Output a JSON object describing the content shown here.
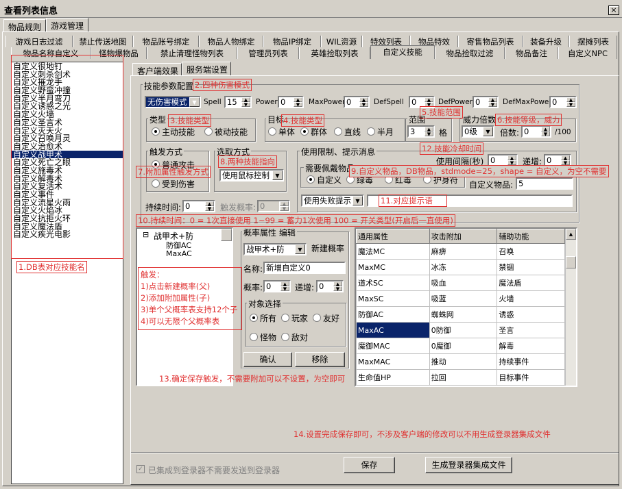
{
  "window": {
    "title": "查看列表信息",
    "close": "×"
  },
  "top_tabs": [
    "物品规则",
    "游戏管理"
  ],
  "func_tabs_row1": [
    "游戏日志过滤",
    "禁止传送地图",
    "物品账号绑定",
    "物品人物绑定",
    "物品IP绑定",
    "WIL资源",
    "特效列表",
    "物品特效",
    "寄售物品列表",
    "装备升级",
    "摆摊列表"
  ],
  "func_tabs_row2": [
    "物品名称自定义",
    "怪物爆物品",
    "禁止清理怪物列表",
    "管理员列表",
    "英雄捡取列表",
    "自定义技能",
    "物品捡取过滤",
    "物品备注",
    "自定义NPC"
  ],
  "skill_list": [
    "自定义很地钉",
    "自定义刺杀剑术",
    "自定义摧龙手",
    "自定义野蛮冲撞",
    "自定义半月弯刀",
    "自定义诱惑之光",
    "自定义火墙",
    "自定义圣言术",
    "自定义灭天火",
    "自定义召唤月灵",
    "自定义治愈术",
    "自定义战甲术",
    "自定义死亡之眼",
    "自定义施毒术",
    "自定义解毒术",
    "自定义复活术",
    "自定义事件",
    "自定义流星火雨",
    "自定义火焰冰",
    "自定义抗拒火环",
    "自定义魔法盾",
    "自定义疾光电影"
  ],
  "sub_tabs": [
    "客户端效果",
    "服务端设置"
  ],
  "params": {
    "group": "技能参数配置",
    "damage_mode": "无伤害模式",
    "spell_label": "Spell",
    "spell": "15",
    "power_label": "Power",
    "power": "0",
    "maxpower_label": "MaxPower",
    "maxpower": "0",
    "defspell_label": "DefSpell",
    "defspell": "0",
    "defpower_label": "DefPower",
    "defpower": "0",
    "defmaxpower_label": "DefMaxPower",
    "defmaxpower": "0"
  },
  "type_group": {
    "label": "类型",
    "opt1": "主动技能",
    "opt2": "被动技能"
  },
  "target_group": {
    "label": "目标",
    "opt1": "单体",
    "opt2": "群体",
    "opt3": "直线",
    "opt4": "半月"
  },
  "range_group": {
    "label": "范围",
    "value": "3",
    "unit": "格"
  },
  "power_group": {
    "label": "威力倍数",
    "level": "0级",
    "mult_label": "倍数:",
    "mult": "0",
    "suffix": "/100"
  },
  "trigger_group": {
    "label": "触发方式",
    "opt1": "普通攻击",
    "opt2": "受到伤害"
  },
  "select_group": {
    "label": "选取方式",
    "value": "使用鼠标控制"
  },
  "limit_group": {
    "label": "使用限制、提示消息",
    "interval_label": "使用间隔(秒)",
    "interval": "0",
    "inc_label": "递增:",
    "inc": "0",
    "item_label": "需要佩戴物品",
    "opt1": "自定义",
    "opt2": "绿毒",
    "opt3": "红毒",
    "opt4": "护身符",
    "custom_item_label": "自定义物品:",
    "custom_item": "5",
    "fail_select": "使用失败提示"
  },
  "duration": {
    "label": "持续时间:",
    "value": "0",
    "prob_label": "触发概率:",
    "prob": "0"
  },
  "tree": {
    "root": "战甲术+防",
    "child1": "防御AC",
    "child2": "MaxAC"
  },
  "prob_group": {
    "label": "概率属性 编辑",
    "select": "战甲术+防",
    "new_label": "新建概率",
    "name_label": "名称:",
    "name": "新增自定义0",
    "prob_label": "概率:",
    "prob": "0",
    "inc_label": "递增:",
    "inc": "0",
    "obj_label": "对象选择",
    "o1": "所有",
    "o2": "玩家",
    "o3": "友好",
    "o4": "怪物",
    "o5": "敌对",
    "confirm": "确认",
    "remove": "移除"
  },
  "attr_table": {
    "headers": [
      "通用属性",
      "攻击附加",
      "辅助功能"
    ],
    "rows": [
      [
        "魔法MC",
        "麻痹",
        "召唤"
      ],
      [
        "MaxMC",
        "冰冻",
        "禁锢"
      ],
      [
        "道术SC",
        "吸血",
        "魔法盾"
      ],
      [
        "MaxSC",
        "吸蓝",
        "火墙"
      ],
      [
        "防御AC",
        "蜘蛛网",
        "诱惑"
      ],
      [
        "MaxAC",
        "0防御",
        "圣言"
      ],
      [
        "魔御MAC",
        "0魔御",
        "解毒"
      ],
      [
        "MaxMAC",
        "推动",
        "持续事件"
      ],
      [
        "生命值HP",
        "拉回",
        "目标事件"
      ]
    ]
  },
  "bottom": {
    "checkbox": "已集成到登录器不需要发送到登录器",
    "save": "保存",
    "gen": "生成登录器集成文件"
  },
  "notes": {
    "n1": "1.DB表对应技能名",
    "n2": "2.四种伤害模式",
    "n3": "3.技能类型",
    "n4": "4.技能类型",
    "n5": "5.技能范围",
    "n6": "6.技能等级，威力",
    "n7": "7.附加属性触发方式",
    "n8": "8.两种技能指向",
    "n9": "9.自定义物品，DB物品，stdmode=25，shape = 自定义，为空不需要",
    "n10": "10.持续时间：0 = 1次直接使用  1~99 = 蓄力1次使用  100 = 开关类型(开启后一直使用)",
    "n11": "11.对应提示语",
    "n12": "12.技能冷却时间",
    "n13": "13.确定保存触发，不需要附加可以不设置，为空即可",
    "n14": "14.设置完成保存即可，不涉及客户端的修改可以不用生成登录器集成文件",
    "trig_title": "触发：",
    "trig1": "1)点击新建概率(父)",
    "trig2": "2)添加附加属性(子)",
    "trig3": "3)单个父概率表支持12个子",
    "trig4": "4)可以无限个父概率表"
  }
}
